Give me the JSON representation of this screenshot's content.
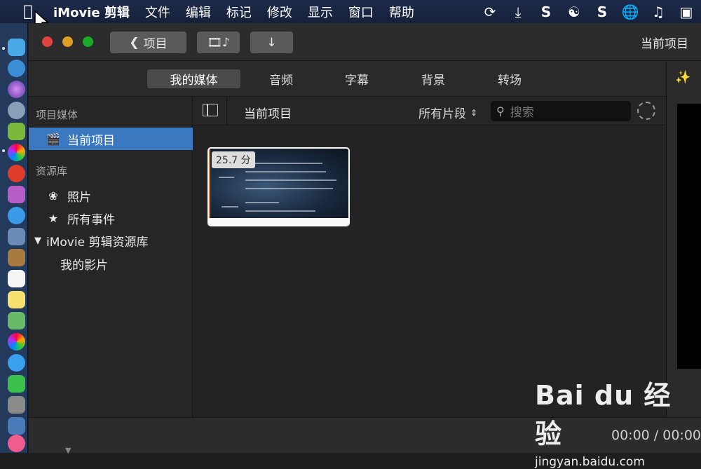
{
  "menubar": {
    "app_name": "iMovie 剪辑",
    "items": [
      "文件",
      "编辑",
      "标记",
      "修改",
      "显示",
      "窗口",
      "帮助"
    ]
  },
  "toolbar": {
    "back_label": "项目",
    "project_title": "当前项目"
  },
  "tabs": [
    "我的媒体",
    "音频",
    "字幕",
    "背景",
    "转场"
  ],
  "sidebar": {
    "section_project_media": "项目媒体",
    "current_project": "当前项目",
    "section_libraries": "资源库",
    "photos": "照片",
    "all_events": "所有事件",
    "library_name": "iMovie 剪辑资源库",
    "my_movie": "我的影片"
  },
  "browser": {
    "header_title": "当前项目",
    "filter_label": "所有片段",
    "search_placeholder": "搜索",
    "clip_duration": "25.7 分"
  },
  "bottombar": {
    "timecode": "00:00 / 00:00"
  },
  "watermark": {
    "brand": "Bai du 经验",
    "url": "jingyan.baidu.com"
  },
  "colors": {
    "selection": "#3a78c0",
    "close": "#e0443e",
    "minimize": "#dea123",
    "zoom": "#1aab29"
  }
}
